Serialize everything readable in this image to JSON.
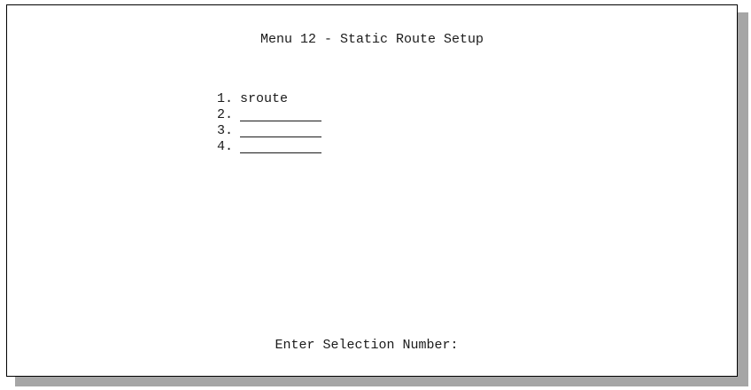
{
  "screen": {
    "title": "Menu 12 - Static Route Setup",
    "menu_items": [
      {
        "number": "1.",
        "name": "sroute"
      },
      {
        "number": "2.",
        "name": ""
      },
      {
        "number": "3.",
        "name": ""
      },
      {
        "number": "4.",
        "name": ""
      }
    ],
    "prompt_label": "Enter Selection Number:",
    "prompt_value": ""
  },
  "colors": {
    "background": "#ffffff",
    "text": "#1a1a1a",
    "border": "#000000",
    "shadow": "#a6a6a6"
  }
}
